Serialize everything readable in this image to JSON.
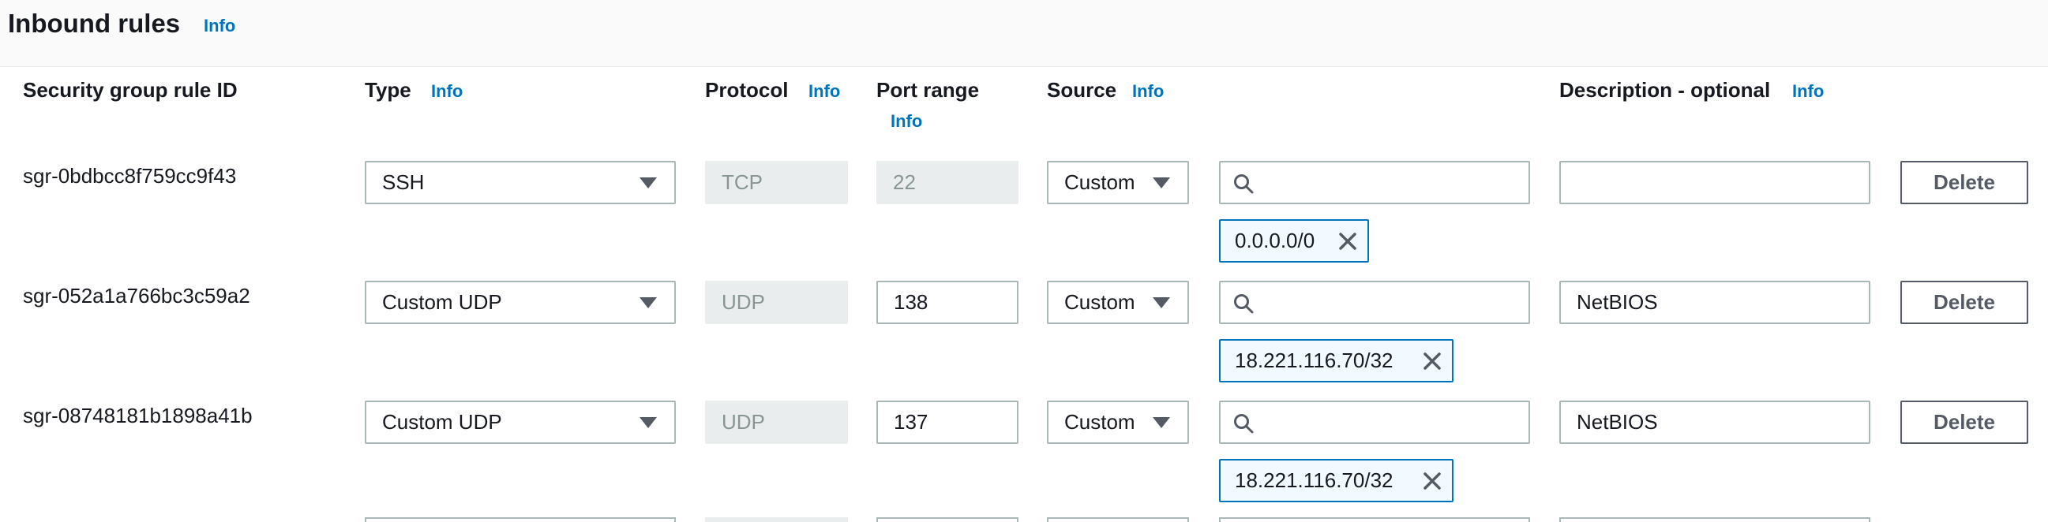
{
  "panel": {
    "title": "Inbound rules",
    "title_info": "Info"
  },
  "columns": {
    "rule_id": "Security group rule ID",
    "type": "Type",
    "type_info": "Info",
    "protocol": "Protocol",
    "protocol_info": "Info",
    "port_range": "Port range",
    "port_range_info": "Info",
    "source": "Source",
    "source_info": "Info",
    "description": "Description - optional",
    "description_info": "Info"
  },
  "rules": [
    {
      "id": "sgr-0bdbcc8f759cc9f43",
      "type": "SSH",
      "protocol": "TCP",
      "port_range": "22",
      "port_editable": false,
      "source": "Custom",
      "cidr_search_value": "",
      "cidr_token": "0.0.0.0/0",
      "description": "",
      "delete_label": "Delete"
    },
    {
      "id": "sgr-052a1a766bc3c59a2",
      "type": "Custom UDP",
      "protocol": "UDP",
      "port_range": "138",
      "port_editable": true,
      "source": "Custom",
      "cidr_search_value": "",
      "cidr_token": "18.221.116.70/32",
      "description": "NetBIOS",
      "delete_label": "Delete"
    },
    {
      "id": "sgr-08748181b1898a41b",
      "type": "Custom UDP",
      "protocol": "UDP",
      "port_range": "137",
      "port_editable": true,
      "source": "Custom",
      "cidr_search_value": "",
      "cidr_token": "18.221.116.70/32",
      "description": "NetBIOS",
      "delete_label": "Delete"
    }
  ],
  "icons": {
    "dropdown": "caret-down-icon",
    "search": "search-icon",
    "remove_token": "close-icon"
  },
  "colors": {
    "link": "#0073bb",
    "token_border": "#0073bb",
    "token_bg": "#f1faff",
    "disabled_bg": "#eaeded",
    "header_bg": "#fafafa"
  }
}
